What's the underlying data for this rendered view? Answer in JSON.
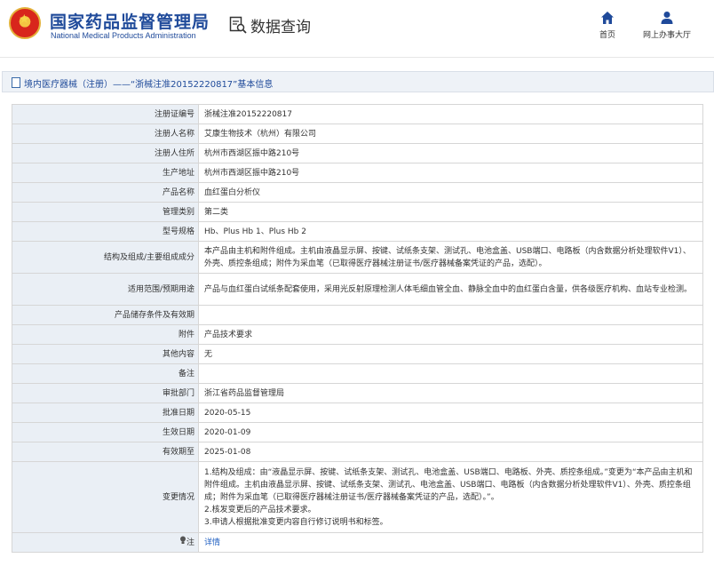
{
  "header": {
    "site_name_cn": "国家药品监督管理局",
    "site_name_en": "National Medical Products Administration",
    "data_query": "数据查询",
    "nav": [
      {
        "label": "首页",
        "icon": "home-icon"
      },
      {
        "label": "网上办事大厅",
        "icon": "user-icon"
      }
    ]
  },
  "title_bar": {
    "text": "境内医疗器械（注册）——“浙械注准20152220817”基本信息"
  },
  "rows": [
    {
      "label": "注册证编号",
      "value": "浙械注准20152220817"
    },
    {
      "label": "注册人名称",
      "value": "艾康生物技术（杭州）有限公司"
    },
    {
      "label": "注册人住所",
      "value": "杭州市西湖区振中路210号"
    },
    {
      "label": "生产地址",
      "value": "杭州市西湖区振中路210号"
    },
    {
      "label": "产品名称",
      "value": "血红蛋白分析仪"
    },
    {
      "label": "管理类别",
      "value": "第二类"
    },
    {
      "label": "型号规格",
      "value": "Hb、Plus Hb 1、Plus Hb 2"
    },
    {
      "label": "结构及组成/主要组成成分",
      "value": "本产品由主机和附件组成。主机由液晶显示屏、按键、试纸条支架、测试孔、电池盒盖、USB端口、电路板（内含数据分析处理软件V1）、外壳、质控条组成；附件为采血笔（已取得医疗器械注册证书/医疗器械备案凭证的产品，选配）。"
    },
    {
      "label": "适用范围/预期用途",
      "value": "产品与血红蛋白试纸条配套使用，采用光反射原理检测人体毛细血管全血、静脉全血中的血红蛋白含量，供各级医疗机构、血站专业检测。"
    },
    {
      "label": "产品储存条件及有效期",
      "value": ""
    },
    {
      "label": "附件",
      "value": "产品技术要求"
    },
    {
      "label": "其他内容",
      "value": "无"
    },
    {
      "label": "备注",
      "value": ""
    },
    {
      "label": "审批部门",
      "value": "浙江省药品监督管理局"
    },
    {
      "label": "批准日期",
      "value": "2020-05-15"
    },
    {
      "label": "生效日期",
      "value": "2020-01-09"
    },
    {
      "label": "有效期至",
      "value": "2025-01-08"
    }
  ],
  "change": {
    "label": "变更情况",
    "lines": [
      "1.结构及组成：由“液晶显示屏、按键、试纸条支架、测试孔、电池盒盖、USB端口、电路板、外壳、质控条组成。”变更为“本产品由主机和附件组成。主机由液晶显示屏、按键、试纸条支架、测试孔、电池盒盖、USB端口、电路板（内含数据分析处理软件V1）、外壳、质控条组成；附件为采血笔（已取得医疗器械注册证书/医疗器械备案凭证的产品，选配）。”。",
      "2.核发变更后的产品技术要求。",
      "3.申请人根据批准变更内容自行修订说明书和标签。"
    ]
  },
  "note": {
    "label": "注",
    "link": "详情"
  }
}
